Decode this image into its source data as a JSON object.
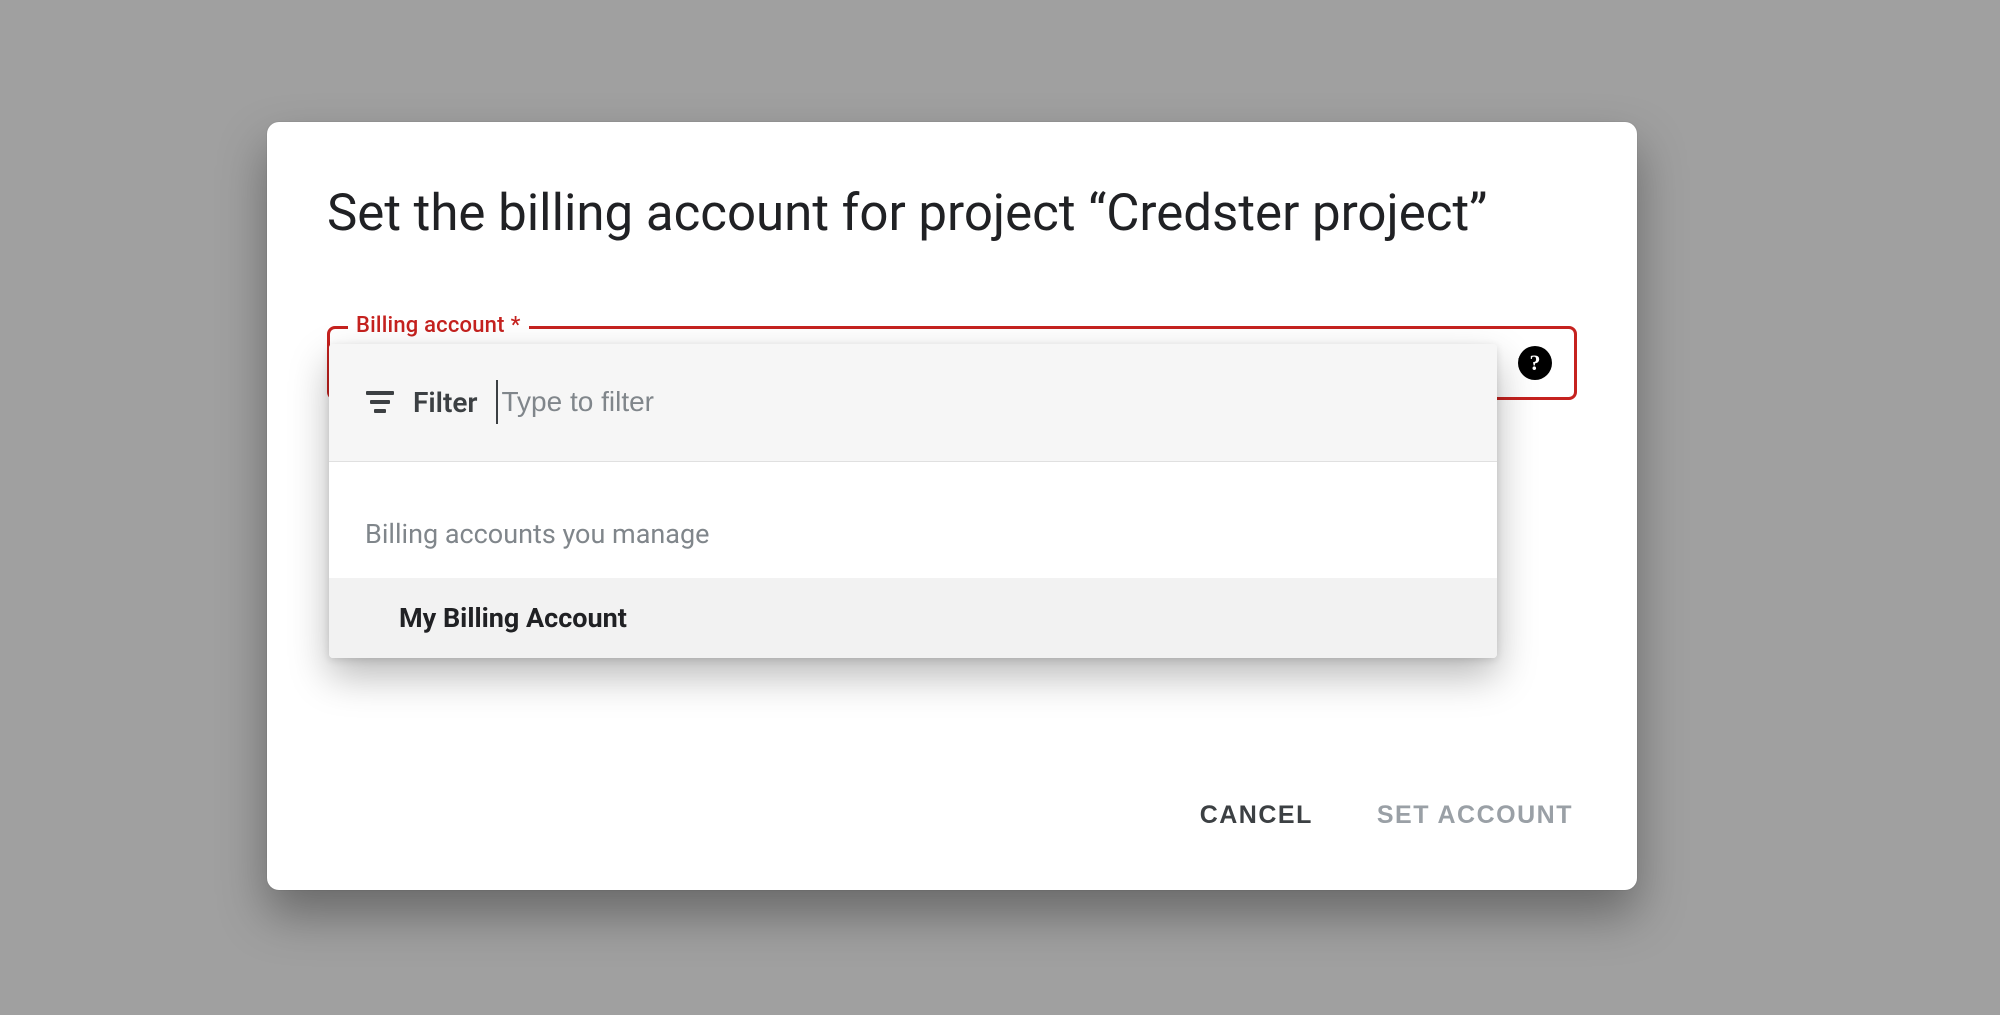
{
  "dialog": {
    "title": "Set the billing account for project “Credster project”"
  },
  "field": {
    "label": "Billing account",
    "required_mark": "*",
    "help_glyph": "?"
  },
  "dropdown": {
    "filter_label": "Filter",
    "filter_placeholder": "Type to filter",
    "group_label": "Billing accounts you manage",
    "options": [
      "My Billing Account"
    ]
  },
  "actions": {
    "cancel": "CANCEL",
    "confirm": "SET ACCOUNT"
  }
}
